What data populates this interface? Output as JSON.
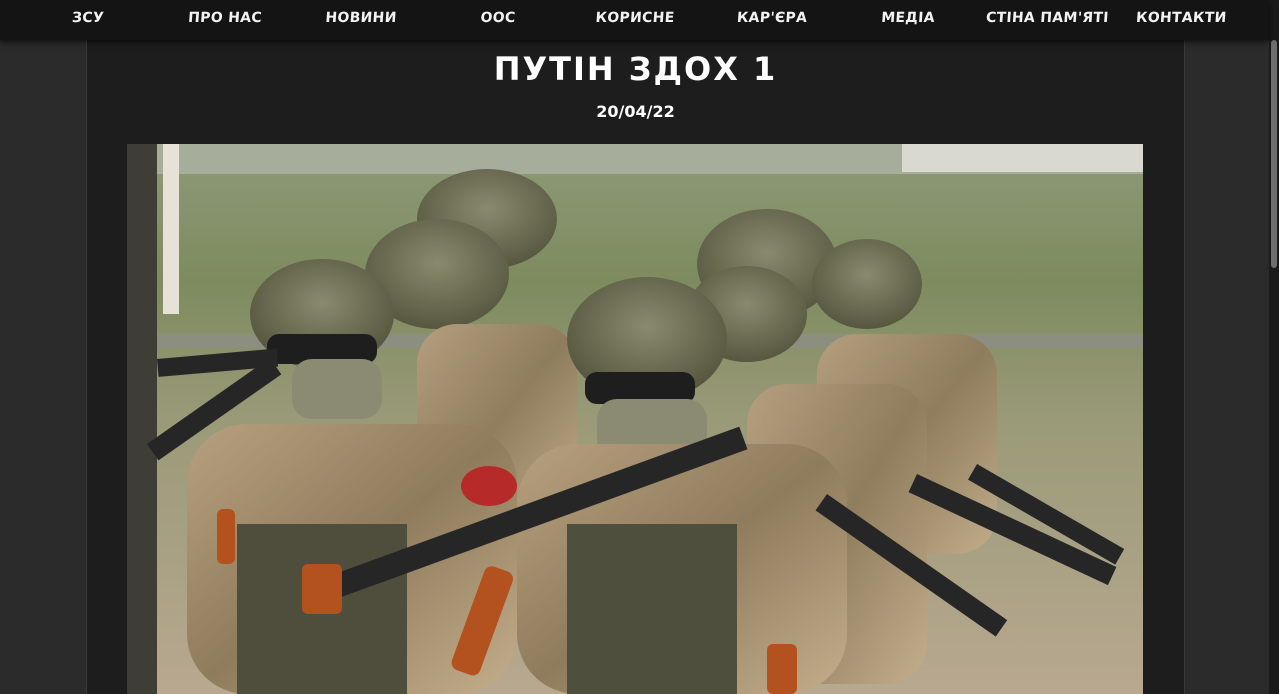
{
  "nav": {
    "items": [
      {
        "label": "ЗСУ"
      },
      {
        "label": "ПРО НАС"
      },
      {
        "label": "НОВИНИ"
      },
      {
        "label": "ООС"
      },
      {
        "label": "КОРИСНЕ"
      },
      {
        "label": "КАР'ЄРА"
      },
      {
        "label": "МЕДІА"
      },
      {
        "label": "СТІНА ПАМ'ЯТІ"
      },
      {
        "label": "КОНТАКТИ"
      }
    ]
  },
  "article": {
    "title": "ПУТІН ЗДОХ 1",
    "date": "20/04/22"
  },
  "colors": {
    "nav_bg": "#141414",
    "page_bg": "#2b2b2b",
    "content_bg": "#1d1d1d",
    "text": "#ffffff"
  }
}
